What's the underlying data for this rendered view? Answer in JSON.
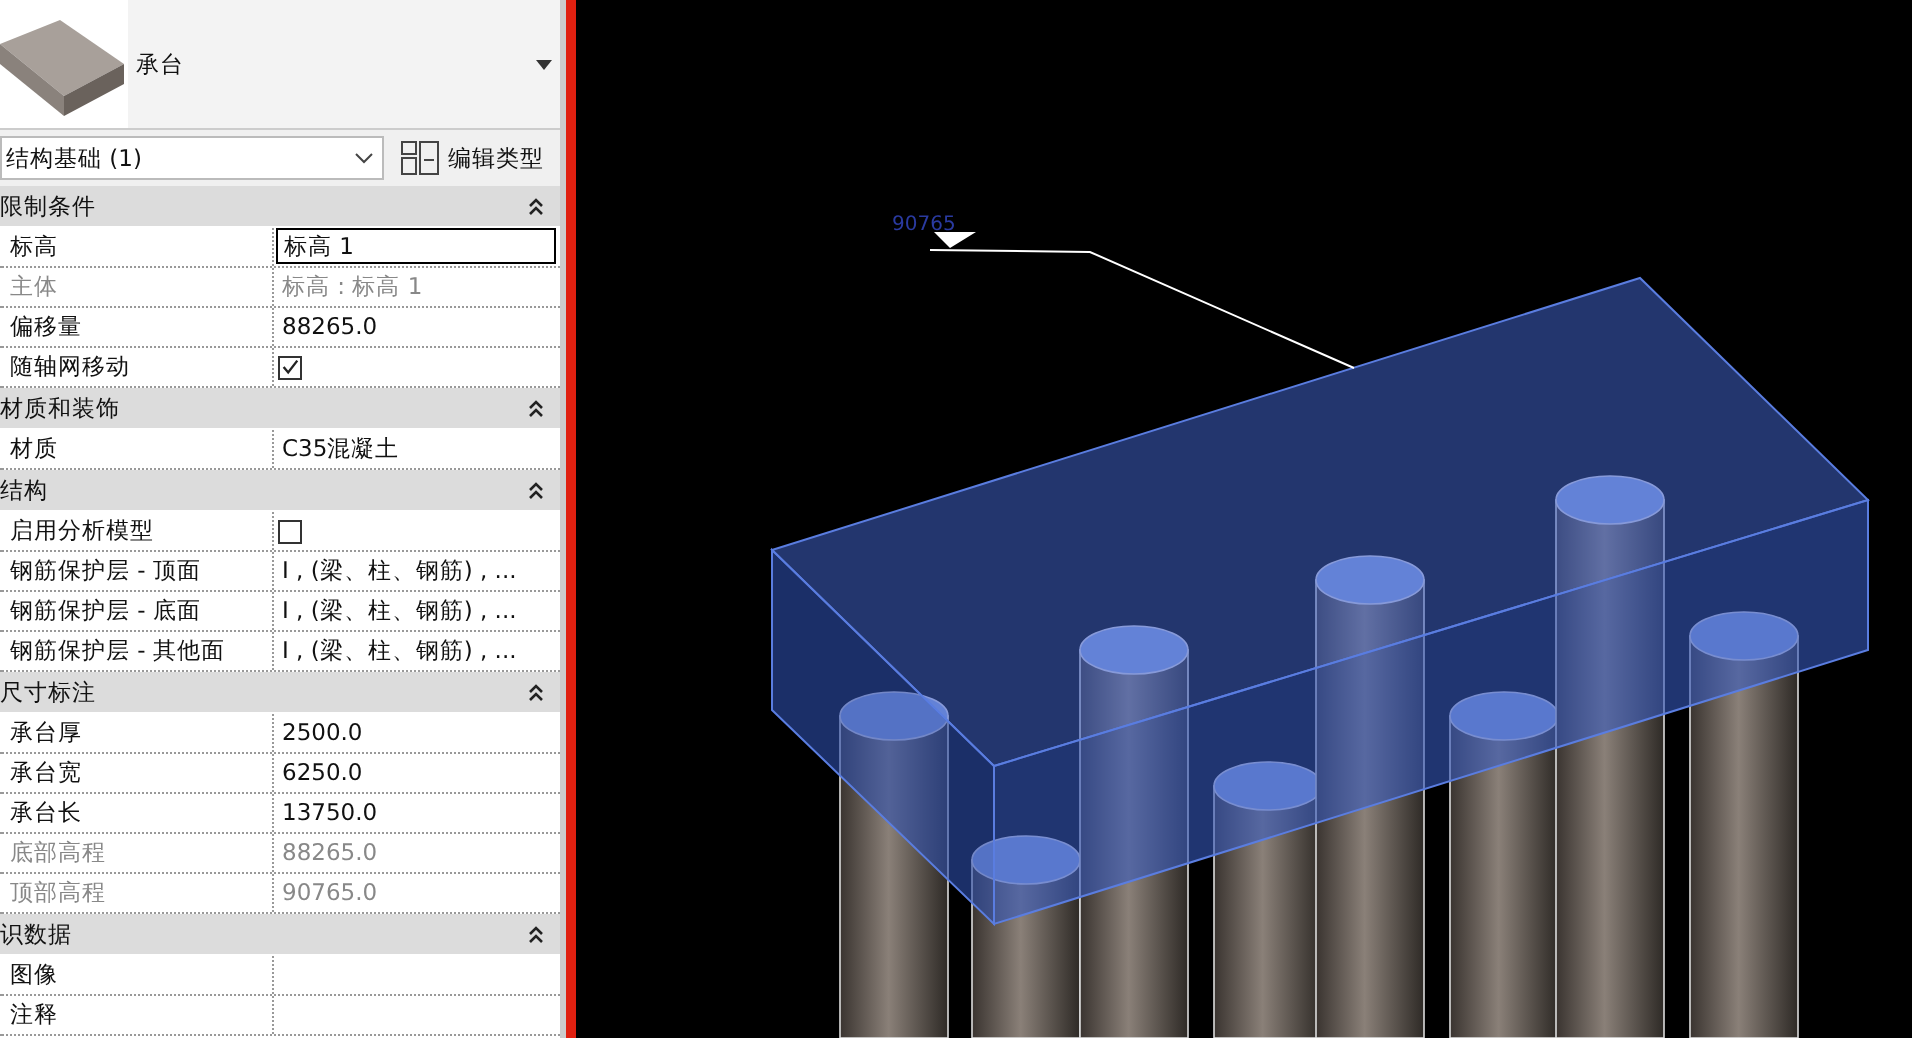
{
  "type_selector": {
    "type_name": "承台"
  },
  "instance_filter": {
    "value": "结构基础 (1)"
  },
  "edit_type_button": {
    "label": "编辑类型"
  },
  "sections": [
    {
      "title": "限制条件",
      "expanded": true,
      "rows": [
        {
          "label": "标高",
          "kind": "text",
          "value": "标高 1",
          "disabled": false,
          "editing": true
        },
        {
          "label": "主体",
          "kind": "text",
          "value": "标高 : 标高 1",
          "disabled": true,
          "editing": false
        },
        {
          "label": "偏移量",
          "kind": "text",
          "value": "88265.0",
          "disabled": false,
          "editing": false
        },
        {
          "label": "随轴网移动",
          "kind": "checkbox",
          "checked": true,
          "disabled": false,
          "editing": false
        }
      ]
    },
    {
      "title": "材质和装饰",
      "expanded": true,
      "rows": [
        {
          "label": "材质",
          "kind": "text",
          "value": "C35混凝土",
          "disabled": false,
          "editing": false
        }
      ]
    },
    {
      "title": "结构",
      "expanded": true,
      "rows": [
        {
          "label": "启用分析模型",
          "kind": "checkbox",
          "checked": false,
          "disabled": false,
          "editing": false
        },
        {
          "label": "钢筋保护层 - 顶面",
          "kind": "text",
          "value": "I , (梁、柱、钢筋) , ...",
          "disabled": false,
          "editing": false
        },
        {
          "label": "钢筋保护层 - 底面",
          "kind": "text",
          "value": "I , (梁、柱、钢筋) , ...",
          "disabled": false,
          "editing": false
        },
        {
          "label": "钢筋保护层 - 其他面",
          "kind": "text",
          "value": "I , (梁、柱、钢筋) , ...",
          "disabled": false,
          "editing": false
        }
      ]
    },
    {
      "title": "尺寸标注",
      "expanded": true,
      "rows": [
        {
          "label": "承台厚",
          "kind": "text",
          "value": "2500.0",
          "disabled": false,
          "editing": false
        },
        {
          "label": "承台宽",
          "kind": "text",
          "value": "6250.0",
          "disabled": false,
          "editing": false
        },
        {
          "label": "承台长",
          "kind": "text",
          "value": "13750.0",
          "disabled": false,
          "editing": false
        },
        {
          "label": "底部高程",
          "kind": "text",
          "value": "88265.0",
          "disabled": true,
          "editing": false
        },
        {
          "label": "顶部高程",
          "kind": "text",
          "value": "90765.0",
          "disabled": true,
          "editing": false
        }
      ]
    },
    {
      "title": "识数据",
      "expanded": true,
      "rows": [
        {
          "label": "图像",
          "kind": "text",
          "value": "",
          "disabled": false,
          "editing": false
        },
        {
          "label": "注释",
          "kind": "text",
          "value": "",
          "disabled": false,
          "editing": false
        }
      ]
    }
  ],
  "viewport": {
    "level_label": "90765"
  }
}
